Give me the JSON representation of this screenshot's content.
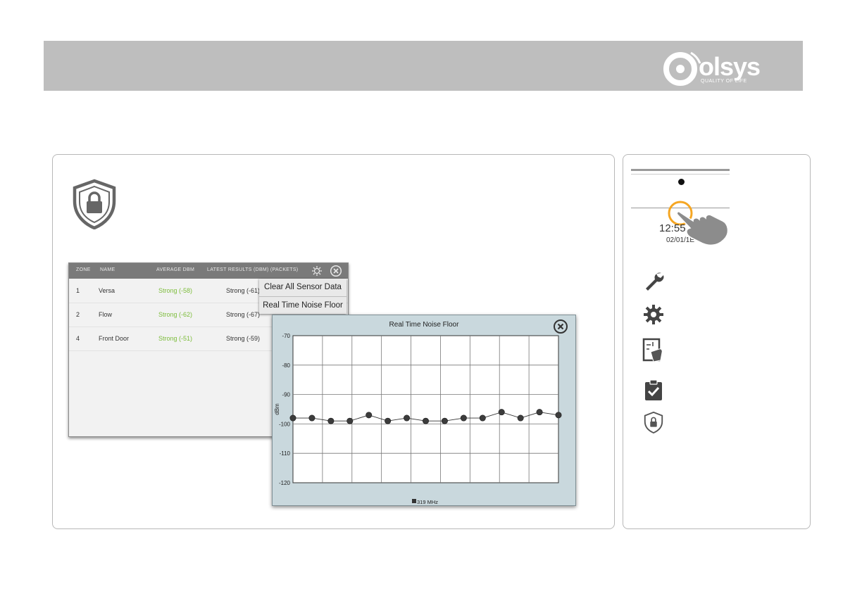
{
  "brand": {
    "name": "olsys",
    "tagline": "QUALITY OF LIFE",
    "header_color": "#bebebe"
  },
  "icons": {
    "security_shield": "shield-lock-icon",
    "close": "close-circle-icon",
    "settings": "gear-icon",
    "tools": "wrench-icon",
    "installation": "touch-panel-icon",
    "test": "clipboard-check-icon",
    "side_security": "shield-lock-icon"
  },
  "sensor_table": {
    "columns": [
      "ZONE",
      "NAME",
      "AVERAGE DBM",
      "LATEST RESULTS (DBM) (PACKETS)"
    ],
    "rows": [
      {
        "zone": "1",
        "name": "Versa",
        "average": "Strong (-58)",
        "latest": "Strong (-61)"
      },
      {
        "zone": "2",
        "name": "Flow",
        "average": "Strong (-62)",
        "latest": "Strong (-67)"
      },
      {
        "zone": "4",
        "name": "Front Door",
        "average": "Strong (-51)",
        "latest": "Strong (-59)"
      }
    ],
    "menu": {
      "clear_all": "Clear All Sensor Data",
      "real_time": "Real Time Noise Floor"
    }
  },
  "chart_data": {
    "type": "line",
    "title": "Real Time Noise Floor",
    "ylabel": "dBm",
    "xlabel": "",
    "ylim": [
      -120,
      -70
    ],
    "y_ticks": [
      -70,
      -80,
      -90,
      -100,
      -110,
      -120
    ],
    "grid": true,
    "legend_position": "bottom",
    "series": [
      {
        "name": "319 MHz",
        "color": "#333333",
        "x": [
          0,
          1,
          2,
          3,
          4,
          5,
          6,
          7,
          8,
          9,
          10,
          11,
          12,
          13,
          14
        ],
        "values": [
          -98,
          -98,
          -99,
          -99,
          -97,
          -99,
          -98,
          -99,
          -99,
          -98,
          -98,
          -96,
          -98,
          -96,
          -97
        ]
      }
    ]
  },
  "side_panel": {
    "time": "12:55 F",
    "date": "02/01/1E",
    "highlight_color": "#f5a623"
  }
}
